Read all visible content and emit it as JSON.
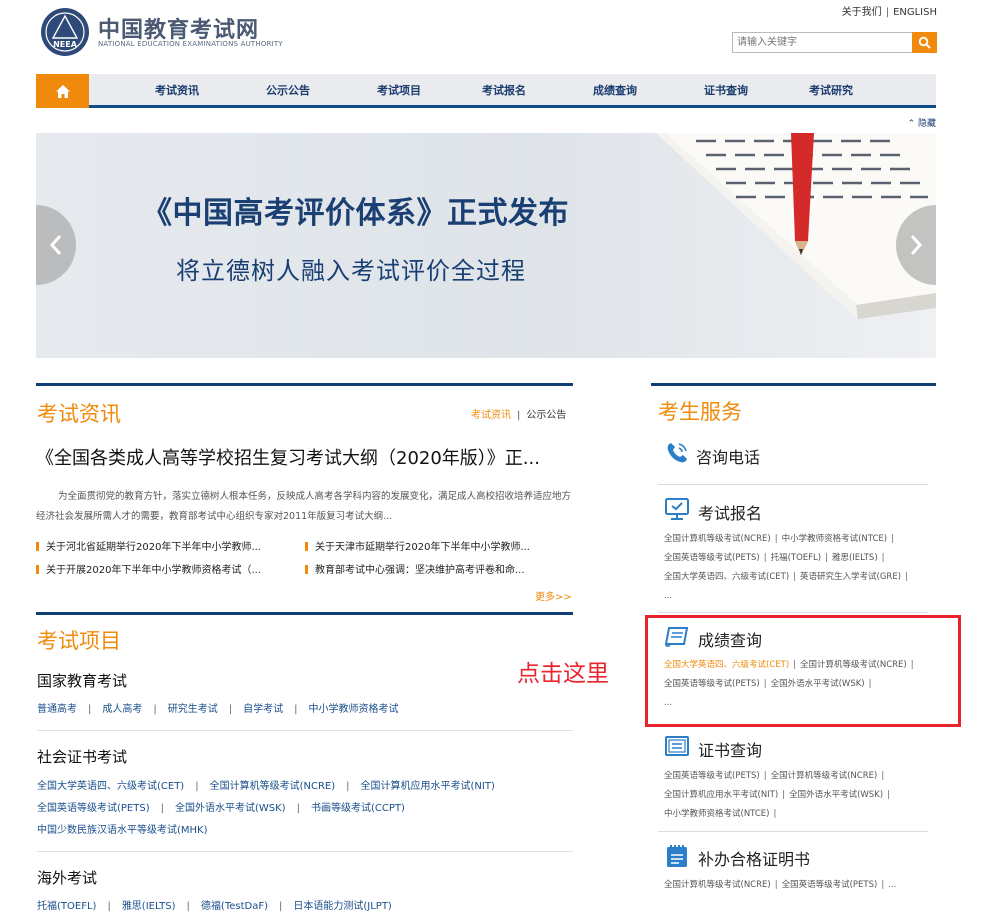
{
  "header": {
    "logo_text": "NEEA",
    "site_name_cn": "中国教育考试网",
    "site_name_en": "NATIONAL EDUCATION EXAMINATIONS AUTHORITY",
    "about": "关于我们",
    "english": "ENGLISH",
    "search_placeholder": "请输入关键字"
  },
  "nav": {
    "items": [
      "考试资讯",
      "公示公告",
      "考试项目",
      "考试报名",
      "成绩查询",
      "证书查询",
      "考试研究"
    ]
  },
  "switch_label": "隐藏",
  "banner": {
    "title": "《中国高考评价体系》正式发布",
    "subtitle": "将立德树人融入考试评价全过程"
  },
  "news_section": {
    "title": "考试资讯",
    "link1": "考试资讯",
    "link2": "公示公告",
    "headline": "《全国各类成人高等学校招生复习考试大纲（2020年版）》正...",
    "summary": "为全面贯彻党的教育方针，落实立德树人根本任务，反映成人高考各学科内容的发展变化，满足成人高校招收培养适应地方经济社会发展所需人才的需要，教育部考试中心组织专家对2011年版复习考试大纲...",
    "items": [
      "关于河北省延期举行2020年下半年中小学教师...",
      "关于天津市延期举行2020年下半年中小学教师...",
      "关于开展2020年下半年中小学教师资格考试（...",
      "教育部考试中心强调：坚决维护高考评卷和命..."
    ],
    "more": "更多>>"
  },
  "projects_section": {
    "title": "考试项目",
    "groups": [
      {
        "title": "国家教育考试",
        "rows": [
          [
            "普通高考",
            "成人高考",
            "研究生考试",
            "自学考试",
            "中小学教师资格考试"
          ]
        ]
      },
      {
        "title": "社会证书考试",
        "rows": [
          [
            "全国大学英语四、六级考试(CET)",
            "全国计算机等级考试(NCRE)",
            "全国计算机应用水平考试(NIT)"
          ],
          [
            "全国英语等级考试(PETS)",
            "全国外语水平考试(WSK)",
            "书画等级考试(CCPT)"
          ],
          [
            "中国少数民族汉语水平等级考试(MHK)"
          ]
        ]
      },
      {
        "title": "海外考试",
        "rows": [
          [
            "托福(TOEFL)",
            "雅思(IELTS)",
            "德福(TestDaF)",
            "日本语能力测试(JLPT)"
          ]
        ]
      }
    ]
  },
  "annotation": "点击这里",
  "services": {
    "title": "考生服务",
    "consult": "咨询电话",
    "registration": {
      "title": "考试报名",
      "links": [
        "全国计算机等级考试(NCRE)",
        "中小学教师资格考试(NTCE)",
        "全国英语等级考试(PETS)",
        "托福(TOEFL)",
        "雅思(IELTS)",
        "全国大学英语四、六级考试(CET)",
        "英语研究生入学考试(GRE)"
      ],
      "ellipsis": "..."
    },
    "score": {
      "title": "成绩查询",
      "links": [
        "全国大学英语四、六级考试(CET)",
        "全国计算机等级考试(NCRE)",
        "全国英语等级考试(PETS)",
        "全国外语水平考试(WSK)"
      ],
      "ellipsis": "..."
    },
    "certificate": {
      "title": "证书查询",
      "links": [
        "全国英语等级考试(PETS)",
        "全国计算机等级考试(NCRE)",
        "全国计算机应用水平考试(NIT)",
        "全国外语水平考试(WSK)",
        "中小学教师资格考试(NTCE)"
      ]
    },
    "reissue": {
      "title": "补办合格证明书",
      "links": [
        "全国计算机等级考试(NCRE)",
        "全国英语等级考试(PETS)"
      ],
      "ellipsis": "..."
    }
  },
  "colors": {
    "accent": "#f08a0c",
    "navy": "#0f3f75",
    "link": "#1a4f8c",
    "annotation": "#e8262d"
  }
}
